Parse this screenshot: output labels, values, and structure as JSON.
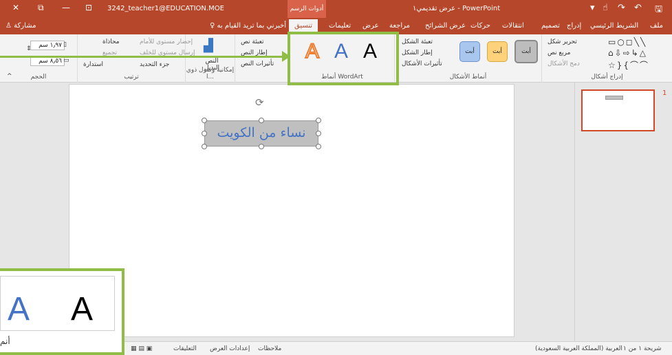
{
  "titlebar": {
    "user": "3242_teacher1@EDUCATION.MOE",
    "context_tab": "أدوات الرسم",
    "app_title": "عرض تقديمي١  -  PowerPoint",
    "close": "✕",
    "restore": "⧉",
    "minimize": "—",
    "ribbon_display": "⊡",
    "save": "🖫",
    "undo": "↶",
    "redo": "↷",
    "touch": "☝",
    "qat_more": "▾"
  },
  "tabs": {
    "file": "ملف",
    "home": "الشريط الرئيسي",
    "insert": "إدراج",
    "design": "تصميم",
    "transitions": "انتقالات",
    "animations": "حركات",
    "slideshow": "عرض الشرائح",
    "review": "مراجعة",
    "view": "عرض",
    "comments": "تعليمات",
    "format": "تنسيق",
    "tellme": "أخبرني بما تريد القيام به",
    "share": "مشاركة"
  },
  "ribbon": {
    "insert_shapes": {
      "label": "إدراج أشكال",
      "edit_shape": "تحرير شكل",
      "text_box": "مربع نص",
      "merge_shapes": "دمج الأشكال"
    },
    "shape_styles": {
      "label": "أنماط الأشكال",
      "swatch_text": "أبت",
      "fill": "تعبئة الشكل",
      "outline": "إطار الشكل",
      "effects": "تأثيرات الأشكال"
    },
    "wordart": {
      "label": "أنماط WordArt",
      "letter": "A",
      "text_fill": "تعبئة نص",
      "text_outline": "إطار النص",
      "text_effects": "تأثيرات النص"
    },
    "accessibility": {
      "label": "إمكانية وصول ذوي ا...",
      "alt_text": "النص البديل"
    },
    "arrange": {
      "label": "ترتيب",
      "bring_forward": "إحضار مستوى للأمام",
      "send_backward": "إرسال مستوى للخلف",
      "selection_pane": "جزء التحديد",
      "align": "محاذاة",
      "group": "تجميع",
      "rotate": "استدارة"
    },
    "size": {
      "label": "الحجم",
      "height": "١٫٩٧ سم",
      "width": "٨٫٥٦ سم"
    },
    "collapse": "^"
  },
  "slide": {
    "textbox_text": "نساء من الكويت"
  },
  "thumbnails": {
    "number": "1"
  },
  "status": {
    "slide_info": "شريحة ١ من ١",
    "language": "العربية (المملكة العربية السعودية)",
    "notes": "ملاحظات",
    "display_settings": "إعدادات العرض",
    "comments": "التعليقات"
  },
  "zoom_callout": {
    "letter": "A",
    "partial_label": "أنم"
  },
  "colors": {
    "title_bar": "#b7472a",
    "accent": "#8fbd45",
    "wordart_orange": "#ed7d31",
    "wordart_blue": "#4472c4"
  }
}
